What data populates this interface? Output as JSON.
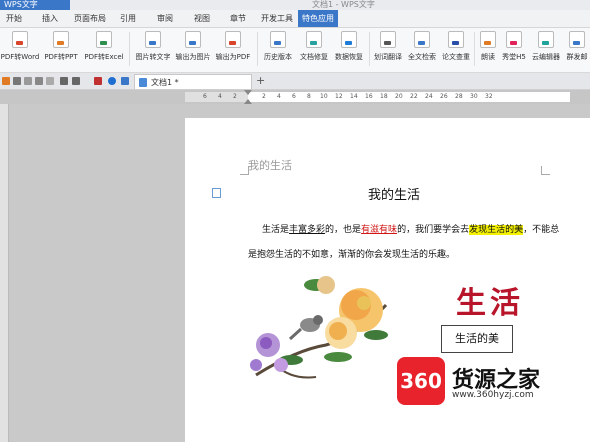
{
  "window": {
    "app_label": "WPS文字",
    "doc_title": "文档1 - WPS文字"
  },
  "menu": {
    "items": [
      "开始",
      "插入",
      "页面布局",
      "引用",
      "审阅",
      "视图",
      "章节",
      "开发工具",
      "特色应用"
    ],
    "active": "特色应用"
  },
  "ribbon": {
    "buttons": [
      {
        "label": "PDF转Word",
        "icon": "pdf-word-icon",
        "color": "#d9452b"
      },
      {
        "label": "PDF转PPT",
        "icon": "pdf-ppt-icon",
        "color": "#e07a24"
      },
      {
        "label": "PDF转Excel",
        "icon": "pdf-excel-icon",
        "color": "#2f8f4e"
      },
      {
        "label": "图片转文字",
        "icon": "image-to-text-icon",
        "color": "#3b77c8"
      },
      {
        "label": "输出为图片",
        "icon": "export-image-icon",
        "color": "#3b77c8"
      },
      {
        "label": "输出为PDF",
        "icon": "export-pdf-icon",
        "color": "#d9452b"
      },
      {
        "label": "历史版本",
        "icon": "history-icon",
        "color": "#3b77c8"
      },
      {
        "label": "文档修复",
        "icon": "repair-icon",
        "color": "#2aa1a1"
      },
      {
        "label": "数据恢复",
        "icon": "data-recovery-icon",
        "color": "#1f7bd8"
      },
      {
        "label": "划词翻译",
        "icon": "translate-icon",
        "color": "#555555"
      },
      {
        "label": "全文检索",
        "icon": "search-icon",
        "color": "#3b77c8"
      },
      {
        "label": "论文查重",
        "icon": "paper-check-icon",
        "color": "#2a4fa8"
      },
      {
        "label": "朗读",
        "icon": "microphone-icon",
        "color": "#e07a24"
      },
      {
        "label": "秀堂H5",
        "icon": "xiutang-icon",
        "color": "#e0245a"
      },
      {
        "label": "云编辑器",
        "icon": "cloud-editor-icon",
        "color": "#1fa39b"
      },
      {
        "label": "群发邮",
        "icon": "mail-icon",
        "color": "#3b77c8"
      }
    ]
  },
  "tabbar": {
    "doc_tab": "文档1 *",
    "new_tab": "+"
  },
  "ruler": {
    "numbers": [
      "6",
      "4",
      "2",
      "2",
      "4",
      "6",
      "8",
      "10",
      "12",
      "14",
      "16",
      "18",
      "20",
      "22",
      "24",
      "26",
      "28",
      "30",
      "32"
    ]
  },
  "document": {
    "header": "我的生活",
    "title": "我的生活",
    "line1": {
      "p1": "生活是",
      "underlined": "丰富多彩",
      "p2": "的，也是",
      "red": "有滋有味",
      "p3": "的，我们要学会去",
      "highlight": "发现生活的美",
      "p4": "，不能总"
    },
    "line2": "是抱怨生活的不如意，渐渐的你会发现生活的乐趣。",
    "wordart": "生活",
    "textbox": "生活的美"
  },
  "watermark": {
    "badge": "360",
    "name": "货源之家",
    "url": "www.360hyzj.com"
  }
}
